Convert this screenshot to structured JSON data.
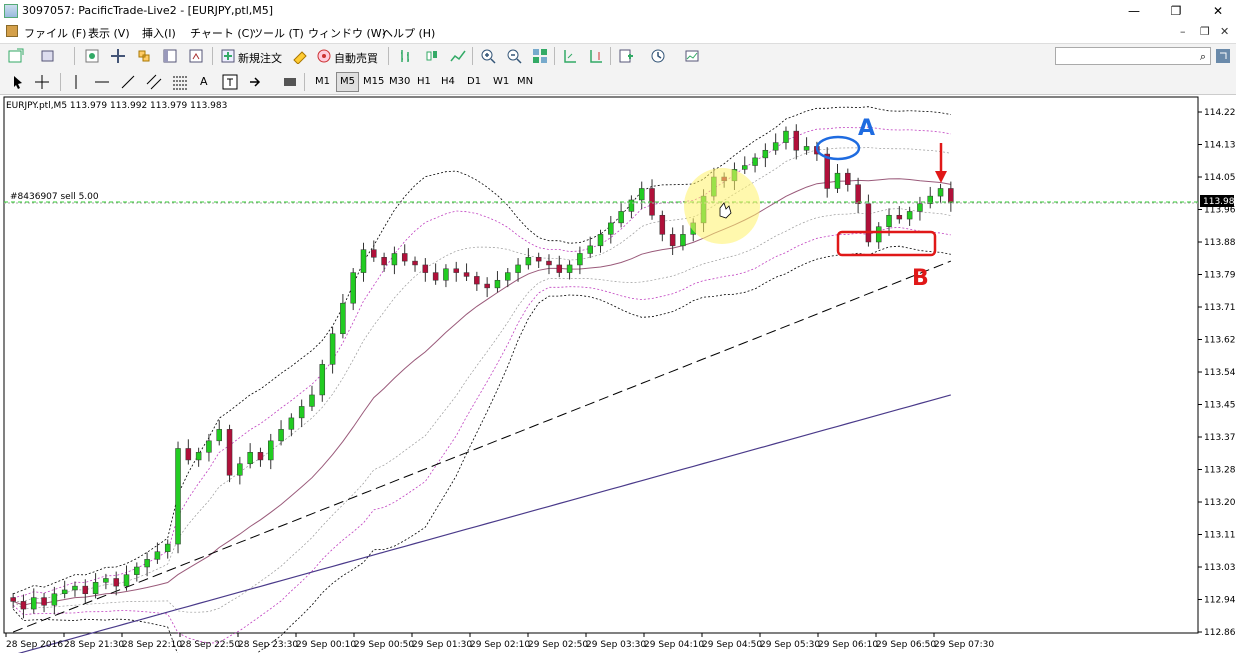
{
  "window": {
    "title": "3097057: PacificTrade-Live2 - [EURJPY,ptl,M5]",
    "minimize": "—",
    "maximize": "❐",
    "close": "✕"
  },
  "menu": [
    "ファイル (F)",
    "表示 (V)",
    "挿入(I)",
    "チャート (C)",
    "ツール (T)",
    "ウィンドウ (W)",
    "ヘルプ (H)"
  ],
  "toolbar": {
    "new_order": "新規注文",
    "auto_trade": "自動売買"
  },
  "timeframes": [
    "M1",
    "M5",
    "M15",
    "M30",
    "H1",
    "H4",
    "D1",
    "W1",
    "MN"
  ],
  "active_timeframe": "M5",
  "chart": {
    "info": "EURJPY.ptl,M5  113.979 113.992 113.979 113.983",
    "order_label": "#8436907 sell 5.00",
    "current_price": "113.983",
    "annotation_a": "A",
    "annotation_b": "B"
  },
  "chart_data": {
    "type": "candlestick",
    "title": "EURJPY.ptl,M5",
    "y_ticks": [
      "114.220",
      "114.135",
      "114.050",
      "113.965",
      "113.880",
      "113.795",
      "113.710",
      "113.625",
      "113.540",
      "113.455",
      "113.370",
      "113.285",
      "113.200",
      "113.115",
      "113.030",
      "112.945",
      "112.860"
    ],
    "x_ticks": [
      "28 Sep 2016",
      "28 Sep 21:30",
      "28 Sep 22:10",
      "28 Sep 22:50",
      "28 Sep 23:30",
      "29 Sep 00:10",
      "29 Sep 00:50",
      "29 Sep 01:30",
      "29 Sep 02:10",
      "29 Sep 02:50",
      "29 Sep 03:30",
      "29 Sep 04:10",
      "29 Sep 04:50",
      "29 Sep 05:30",
      "29 Sep 06:10",
      "29 Sep 06:50",
      "29 Sep 07:30"
    ],
    "ylim": [
      112.86,
      114.22
    ],
    "close": [
      112.94,
      112.92,
      112.95,
      112.93,
      112.96,
      112.97,
      112.98,
      112.96,
      112.99,
      113.0,
      112.98,
      113.01,
      113.03,
      113.05,
      113.07,
      113.09,
      113.34,
      113.31,
      113.33,
      113.36,
      113.39,
      113.27,
      113.3,
      113.33,
      113.31,
      113.36,
      113.39,
      113.42,
      113.45,
      113.48,
      113.56,
      113.64,
      113.72,
      113.8,
      113.86,
      113.84,
      113.82,
      113.85,
      113.83,
      113.82,
      113.8,
      113.78,
      113.81,
      113.8,
      113.79,
      113.77,
      113.76,
      113.78,
      113.8,
      113.82,
      113.84,
      113.83,
      113.82,
      113.8,
      113.82,
      113.85,
      113.87,
      113.9,
      113.93,
      113.96,
      113.99,
      114.02,
      113.95,
      113.9,
      113.87,
      113.9,
      113.93,
      114.0,
      114.05,
      114.04,
      114.07,
      114.08,
      114.1,
      114.12,
      114.14,
      114.17,
      114.12,
      114.13,
      114.11,
      114.02,
      114.06,
      114.03,
      113.98,
      113.88,
      113.92,
      113.95,
      113.94,
      113.96,
      113.98,
      114.0,
      114.02,
      113.983
    ]
  }
}
